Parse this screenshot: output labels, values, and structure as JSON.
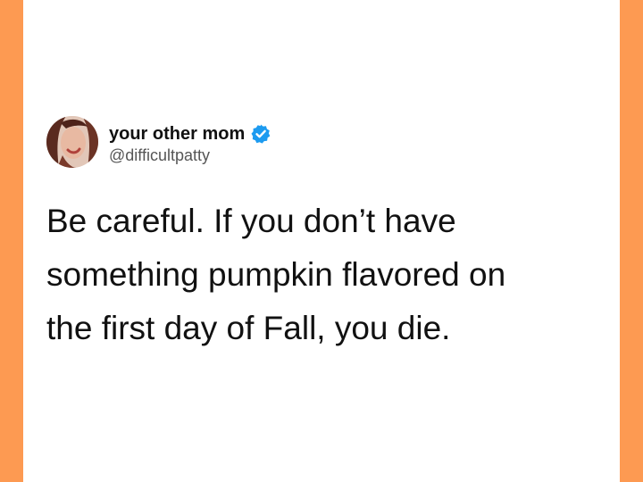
{
  "colors": {
    "side_bar": "#fd9a52",
    "background": "#ffffff",
    "verified_badge": "#1d9bf0",
    "text_primary": "#111111",
    "text_secondary": "#555555"
  },
  "tweet": {
    "author": {
      "display_name": "your other mom",
      "handle": "@difficultpatty",
      "verified": true,
      "avatar_icon": "profile-photo",
      "badge_icon": "verified-badge-icon"
    },
    "text_lines": [
      "Be careful. If you don’t have",
      "something pumpkin flavored on",
      "the first day of Fall, you die."
    ]
  }
}
